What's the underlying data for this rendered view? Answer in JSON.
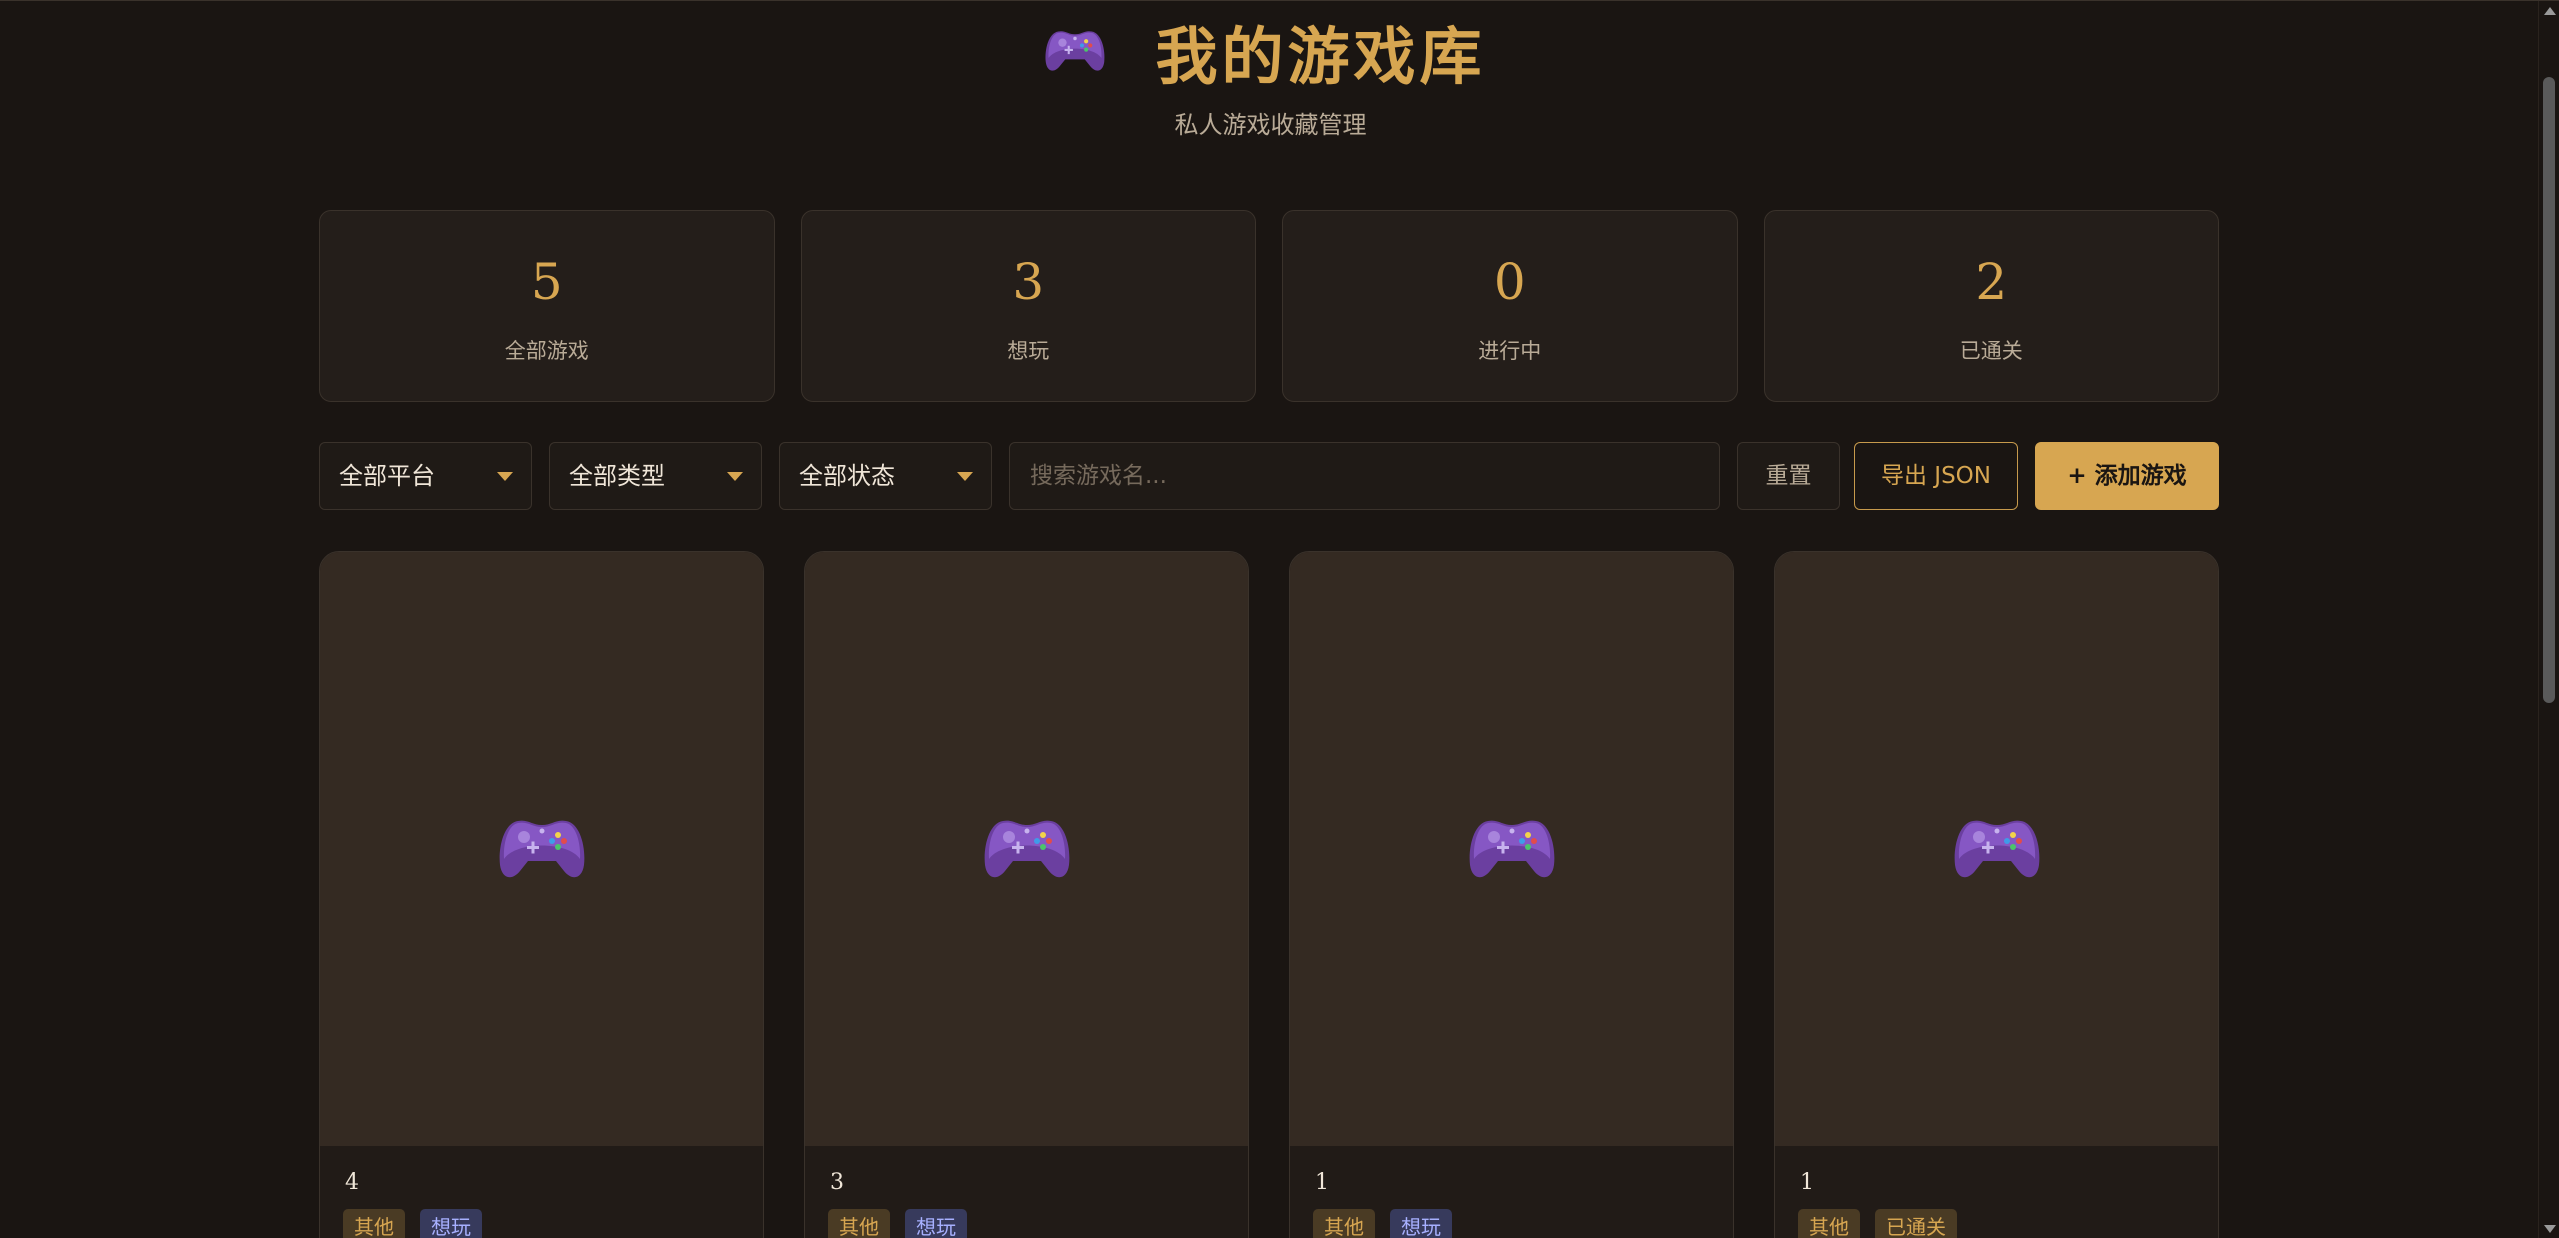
{
  "header": {
    "title": "我的游戏库",
    "subtitle": "私人游戏收藏管理",
    "icon": "gamepad-icon"
  },
  "stats": [
    {
      "value": "5",
      "label": "全部游戏"
    },
    {
      "value": "3",
      "label": "想玩"
    },
    {
      "value": "0",
      "label": "进行中"
    },
    {
      "value": "2",
      "label": "已通关"
    }
  ],
  "filters": {
    "platform": "全部平台",
    "genre": "全部类型",
    "status": "全部状态",
    "search_placeholder": "搜索游戏名..."
  },
  "actions": {
    "reset": "重置",
    "export": "导出 JSON",
    "add": "+ 添加游戏"
  },
  "games": [
    {
      "title": "4",
      "tags": [
        "其他",
        "想玩"
      ]
    },
    {
      "title": "3",
      "tags": [
        "其他",
        "想玩"
      ]
    },
    {
      "title": "1",
      "tags": [
        "其他",
        "想玩"
      ]
    },
    {
      "title": "1",
      "tags": [
        "其他",
        "已通关"
      ]
    }
  ],
  "colors": {
    "background": "#1a1512",
    "accent": "#d7a651",
    "card": "#211b17",
    "cover": "#342a22",
    "tag_want": "#373a5c"
  }
}
